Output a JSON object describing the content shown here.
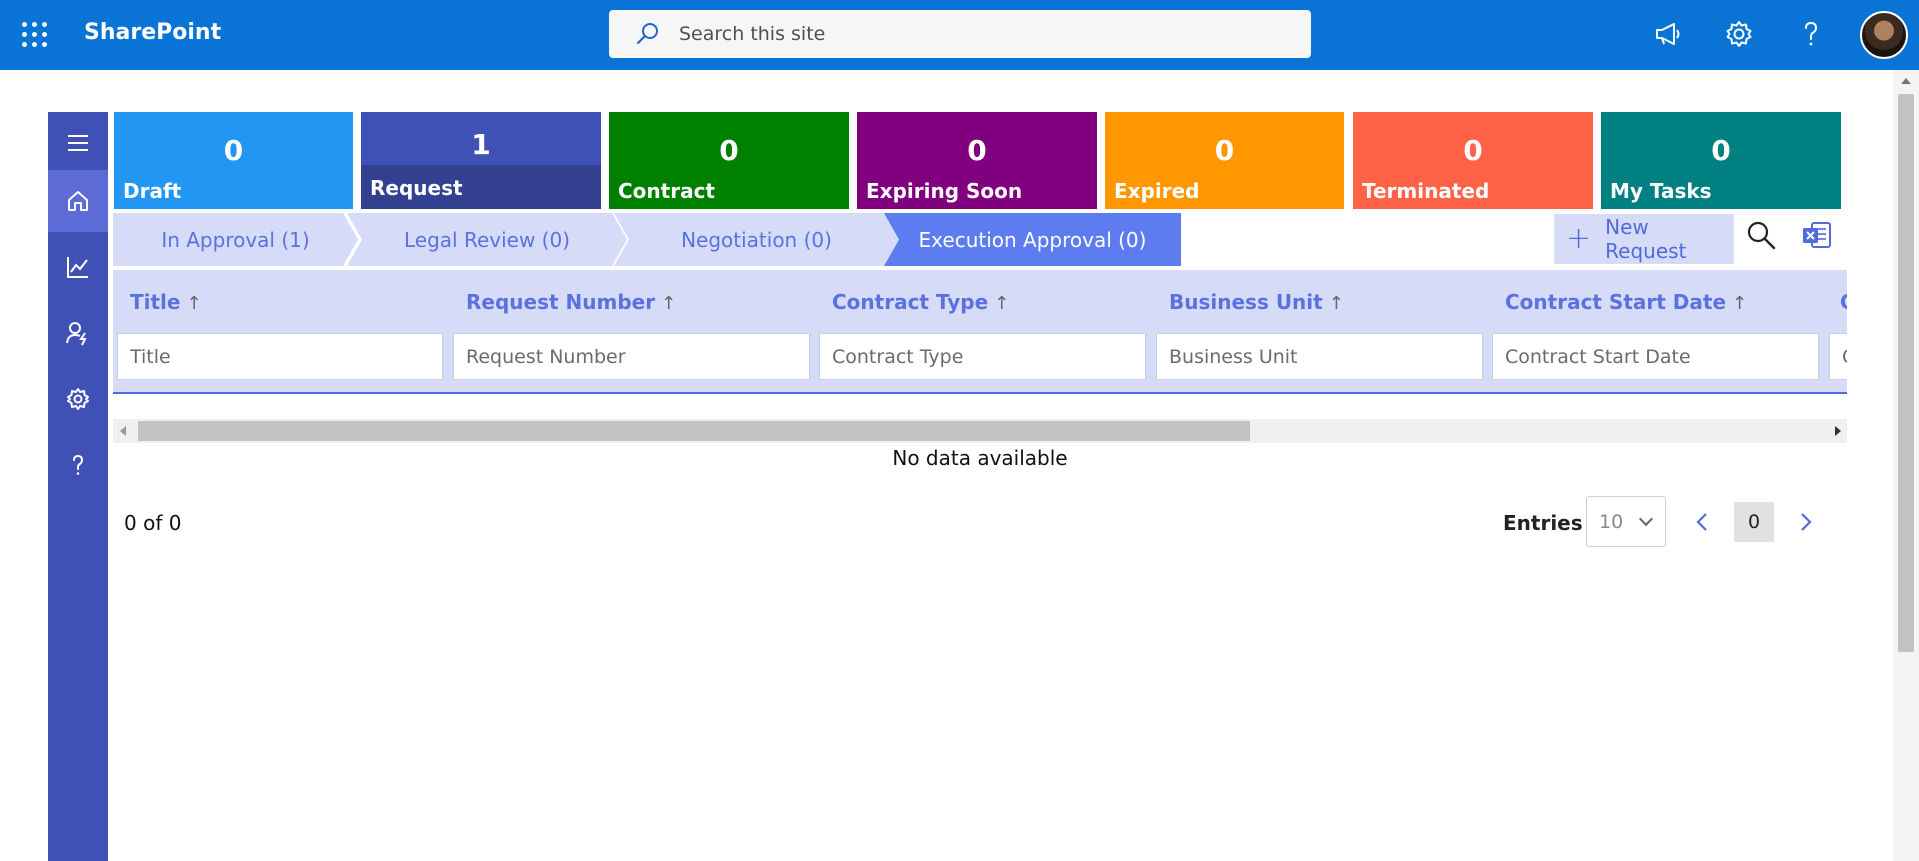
{
  "suitebar": {
    "app_name": "SharePoint",
    "search_placeholder": "Search this site",
    "icons": [
      "waffle-icon",
      "search-icon",
      "megaphone-icon",
      "gear-icon",
      "help-icon",
      "avatar"
    ]
  },
  "nav_rail": {
    "items": [
      "menu-icon",
      "home-icon",
      "chart-icon",
      "user-manage-icon",
      "gear-icon",
      "help-icon"
    ],
    "active": "home-icon"
  },
  "tiles": [
    {
      "count": "0",
      "label": "Draft",
      "color": "#2196f3"
    },
    {
      "count": "1",
      "label": "Request",
      "color": "#3f51b5"
    },
    {
      "count": "0",
      "label": "Contract",
      "color": "#008000"
    },
    {
      "count": "0",
      "label": "Expiring Soon",
      "color": "#800080"
    },
    {
      "count": "0",
      "label": "Expired",
      "color": "#ff9800"
    },
    {
      "count": "0",
      "label": "Terminated",
      "color": "#ff6347"
    },
    {
      "count": "0",
      "label": "My Tasks",
      "color": "#008080"
    }
  ],
  "stages": [
    {
      "label": "In Approval (1)",
      "active": false
    },
    {
      "label": "Legal Review (0)",
      "active": false
    },
    {
      "label": "Negotiation (0)",
      "active": false
    },
    {
      "label": "Execution Approval (0)",
      "active": true
    }
  ],
  "toolbar": {
    "new_request_label": "New Request",
    "icons": [
      "search-icon",
      "excel-export-icon"
    ]
  },
  "grid": {
    "columns": [
      {
        "title": "Title",
        "filter_placeholder": "Title",
        "sort": "↑"
      },
      {
        "title": "Request Number",
        "filter_placeholder": "Request Number",
        "sort": "↑"
      },
      {
        "title": "Contract Type",
        "filter_placeholder": "Contract Type",
        "sort": "↑"
      },
      {
        "title": "Business Unit",
        "filter_placeholder": "Business Unit",
        "sort": "↑"
      },
      {
        "title": "Contract Start Date",
        "filter_placeholder": "Contract Start Date",
        "sort": "↑"
      },
      {
        "title": "C",
        "filter_placeholder": "C",
        "sort": ""
      }
    ],
    "empty_message": "No data available"
  },
  "pager": {
    "range_text": "0 of 0",
    "entries_label": "Entries",
    "entries_value": "10",
    "current_page": "0"
  },
  "colors": {
    "suitebar": "#0a74d6",
    "rail": "#3f51b5",
    "accent": "#4f6bdc",
    "stage_inactive": "#d6dbf7",
    "stage_active": "#5c7cf0"
  }
}
